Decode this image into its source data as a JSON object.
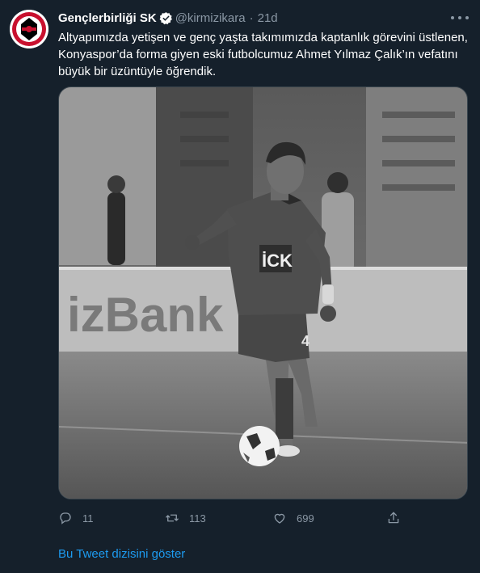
{
  "tweet": {
    "author_name": "Gençlerbirliği SK",
    "handle": "@kirmizikara",
    "separator": "·",
    "time": "21d",
    "text_lines": [
      "Altyapımızda yetişen ve genç yaşta takımımızda kaptanlık görevini üstlenen,",
      "Konyaspor’da forma giyen eski futbolcumuz Ahmet Yılmaz Çalık’ın vefatını",
      "büyük bir üzüntüyle öğrendik."
    ],
    "avatar_text": "ANKARA",
    "media": {
      "banner_text": "izBank",
      "jersey_text": "İCK",
      "number_text": "4"
    },
    "actions": {
      "reply_icon": "reply-icon",
      "reply_count": "11",
      "retweet_icon": "retweet-icon",
      "retweet_count": "113",
      "like_icon": "heart-icon",
      "like_count": "699",
      "share_icon": "share-icon"
    },
    "show_thread": "Bu Tweet dizisini göster"
  },
  "colors": {
    "background": "#15202b",
    "text_primary": "#ffffff",
    "text_secondary": "#8b98a5",
    "accent": "#1d9bf0"
  }
}
